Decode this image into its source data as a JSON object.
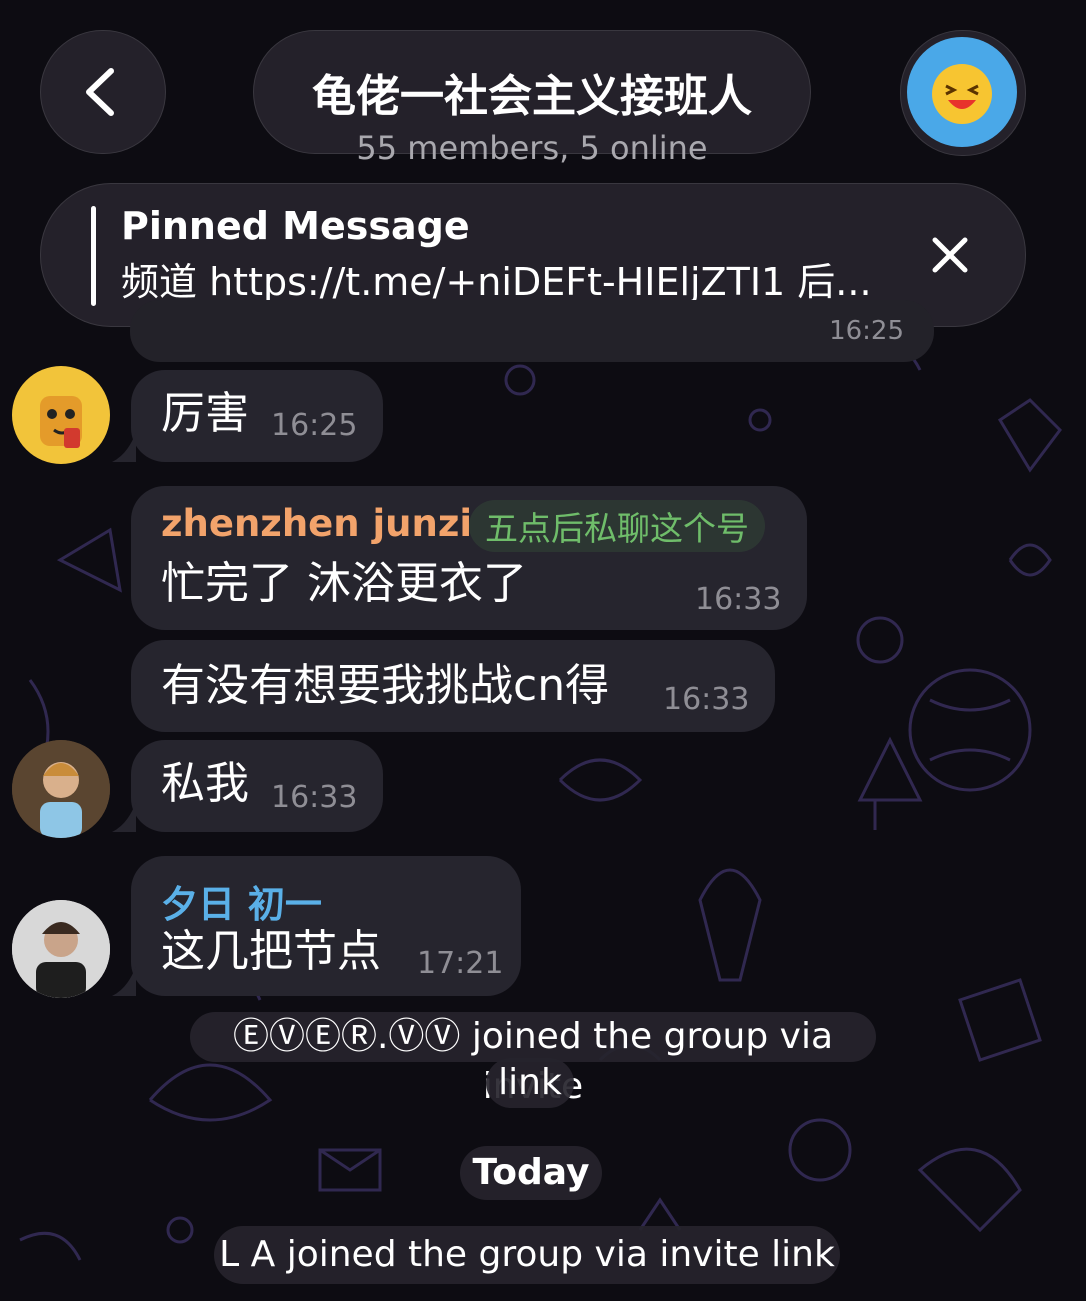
{
  "header": {
    "title": "龟佬一社会主义接班人",
    "subtitle": "55 members, 5 online",
    "back_icon": "chevron-left-icon",
    "group_avatar_icon": "laughing-face-icon"
  },
  "pinned": {
    "title": "Pinned Message",
    "text": "频道 https://t.me/+niDEFt-HIEljZTI1 后...",
    "close_icon": "close-icon"
  },
  "peek_time": "16:25",
  "messages": [
    {
      "text": "厉害",
      "time": "16:25"
    },
    {
      "sender": "zhenzhen junzi",
      "sender_color": "#f2a36b",
      "tag": "五点后私聊这个号",
      "text": "忙完了 沐浴更衣了",
      "time": "16:33"
    },
    {
      "text": "有没有想要我挑战cn得",
      "time": "16:33"
    },
    {
      "text": "私我",
      "time": "16:33"
    },
    {
      "sender": "夕日 初一",
      "sender_color": "#5ab0e8",
      "text": "这几把节点",
      "time": "17:21"
    }
  ],
  "service": {
    "joined1_line1": "ⒺⓋⒺⓇ.ⓋⓋ joined the group via invite",
    "joined1_line2": "link",
    "today": "Today",
    "joined2": "L A joined the group via invite link"
  },
  "colors": {
    "background": "#0d0c12",
    "bubble": "#26252e",
    "time": "#8f8e95",
    "tag": "#6fbd6a"
  }
}
